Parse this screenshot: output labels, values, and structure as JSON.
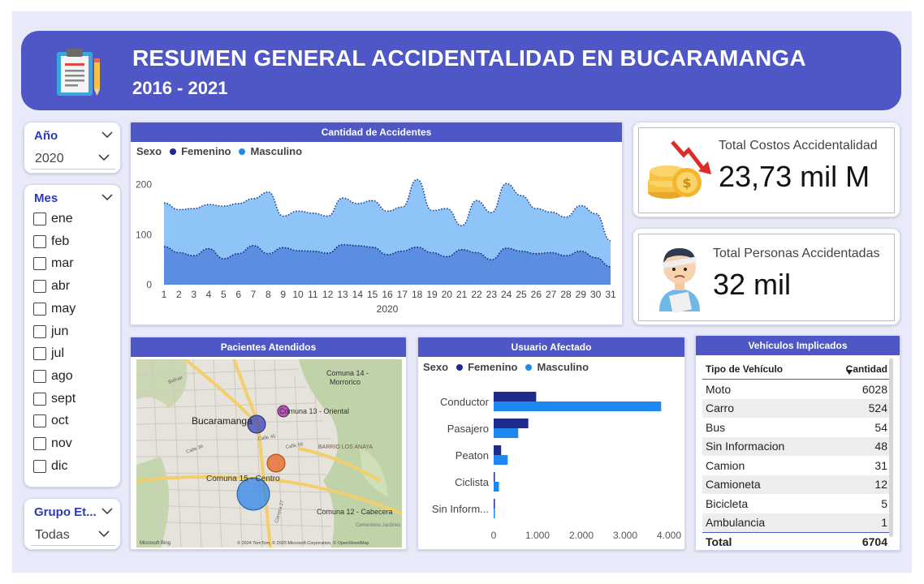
{
  "header": {
    "title": "RESUMEN GENERAL ACCIDENTALIDAD EN BUCARAMANGA",
    "subtitle": "2016 - 2021",
    "icon": "clipboard-icon"
  },
  "slicers": {
    "year": {
      "title": "Año",
      "value": "2020"
    },
    "month": {
      "title": "Mes",
      "items": [
        "ene",
        "feb",
        "mar",
        "abr",
        "may",
        "jun",
        "jul",
        "ago",
        "sept",
        "oct",
        "nov",
        "dic"
      ]
    },
    "age_group": {
      "title": "Grupo Et...",
      "value": "Todas"
    }
  },
  "accidents_chart": {
    "title": "Cantidad de Accidentes",
    "legend_title": "Sexo",
    "xlabel": "2020",
    "chart_data": {
      "type": "area",
      "x": [
        1,
        2,
        3,
        4,
        5,
        6,
        7,
        8,
        9,
        10,
        11,
        12,
        13,
        14,
        15,
        16,
        17,
        18,
        19,
        20,
        21,
        22,
        23,
        24,
        25,
        26,
        27,
        28,
        29,
        30,
        31
      ],
      "ylim": [
        0,
        230
      ],
      "yticks": [
        0,
        100,
        200
      ],
      "series": [
        {
          "name": "Femenino",
          "color": "#5b8ee0",
          "values": [
            76,
            64,
            58,
            72,
            52,
            62,
            78,
            62,
            74,
            68,
            67,
            63,
            80,
            78,
            75,
            60,
            67,
            75,
            64,
            56,
            70,
            64,
            50,
            73,
            67,
            62,
            64,
            58,
            67,
            54,
            36
          ]
        },
        {
          "name": "Masculino",
          "color": "#8fc4f8",
          "values": [
            163,
            150,
            152,
            160,
            157,
            162,
            172,
            185,
            137,
            147,
            143,
            137,
            173,
            162,
            168,
            147,
            155,
            210,
            148,
            152,
            118,
            168,
            144,
            202,
            178,
            152,
            145,
            135,
            158,
            142,
            88
          ]
        }
      ]
    }
  },
  "kpis": {
    "costs": {
      "label": "Total Costos Accidentalidad",
      "value": "23,73 mil M",
      "icon": "coins-down-icon"
    },
    "people": {
      "label": "Total Personas Accidentadas",
      "value": "32 mil",
      "icon": "injured-person-icon"
    }
  },
  "map": {
    "title": "Pacientes Atendidos",
    "labels": {
      "comuna14": "Comuna 14 -",
      "morrorico": "Morrorico",
      "comuna13": "Comuna 13 - Oriental",
      "bucaramanga": "Bucaramanga",
      "barrio": "BARRIO LOS ANAYA",
      "comuna15": "Comuna 15 - Centro",
      "comuna12": "Comuna 12 - Cabecera",
      "cementerio": "Cementerio Jardines",
      "bolivar": "Bolívar",
      "calle36": "Calle 36",
      "calle45": "Calle 45",
      "calle56": "Calle 56",
      "carrera27": "Carrera 27"
    },
    "attribution": "© 2024 TomTom, © 2025 Microsoft Corporation, © OpenStreetMap",
    "brand": "Microsoft Bing"
  },
  "user_chart": {
    "title": "Usuario Afectado",
    "legend_title": "Sexo",
    "chart_data": {
      "type": "bar",
      "orientation": "horizontal",
      "categories": [
        "Conductor",
        "Pasajero",
        "Peaton",
        "Ciclista",
        "Sin Inform..."
      ],
      "xlim": [
        0,
        4000
      ],
      "xticks": [
        "0",
        "1.000",
        "2.000",
        "3.000",
        "4.000"
      ],
      "series": [
        {
          "name": "Femenino",
          "color": "#1f2b8c",
          "values": [
            970,
            790,
            170,
            20,
            5
          ]
        },
        {
          "name": "Masculino",
          "color": "#1e88f0",
          "values": [
            3820,
            560,
            320,
            120,
            15
          ]
        }
      ]
    }
  },
  "vehicles": {
    "title": "Vehículos Implicados",
    "col_type": "Tipo de Vehículo",
    "col_qty": "Cantidad",
    "rows": [
      {
        "type": "Moto",
        "qty": "6028"
      },
      {
        "type": "Carro",
        "qty": "524"
      },
      {
        "type": "Bus",
        "qty": "54"
      },
      {
        "type": "Sin Informacion",
        "qty": "48"
      },
      {
        "type": "Camion",
        "qty": "31"
      },
      {
        "type": "Camioneta",
        "qty": "12"
      },
      {
        "type": "Bicicleta",
        "qty": "5"
      },
      {
        "type": "Ambulancia",
        "qty": "1"
      }
    ],
    "total_label": "Total",
    "total_value": "6704"
  },
  "colors": {
    "brand": "#4f57c6",
    "female": "#1f2b8c",
    "male": "#1e88f0"
  }
}
